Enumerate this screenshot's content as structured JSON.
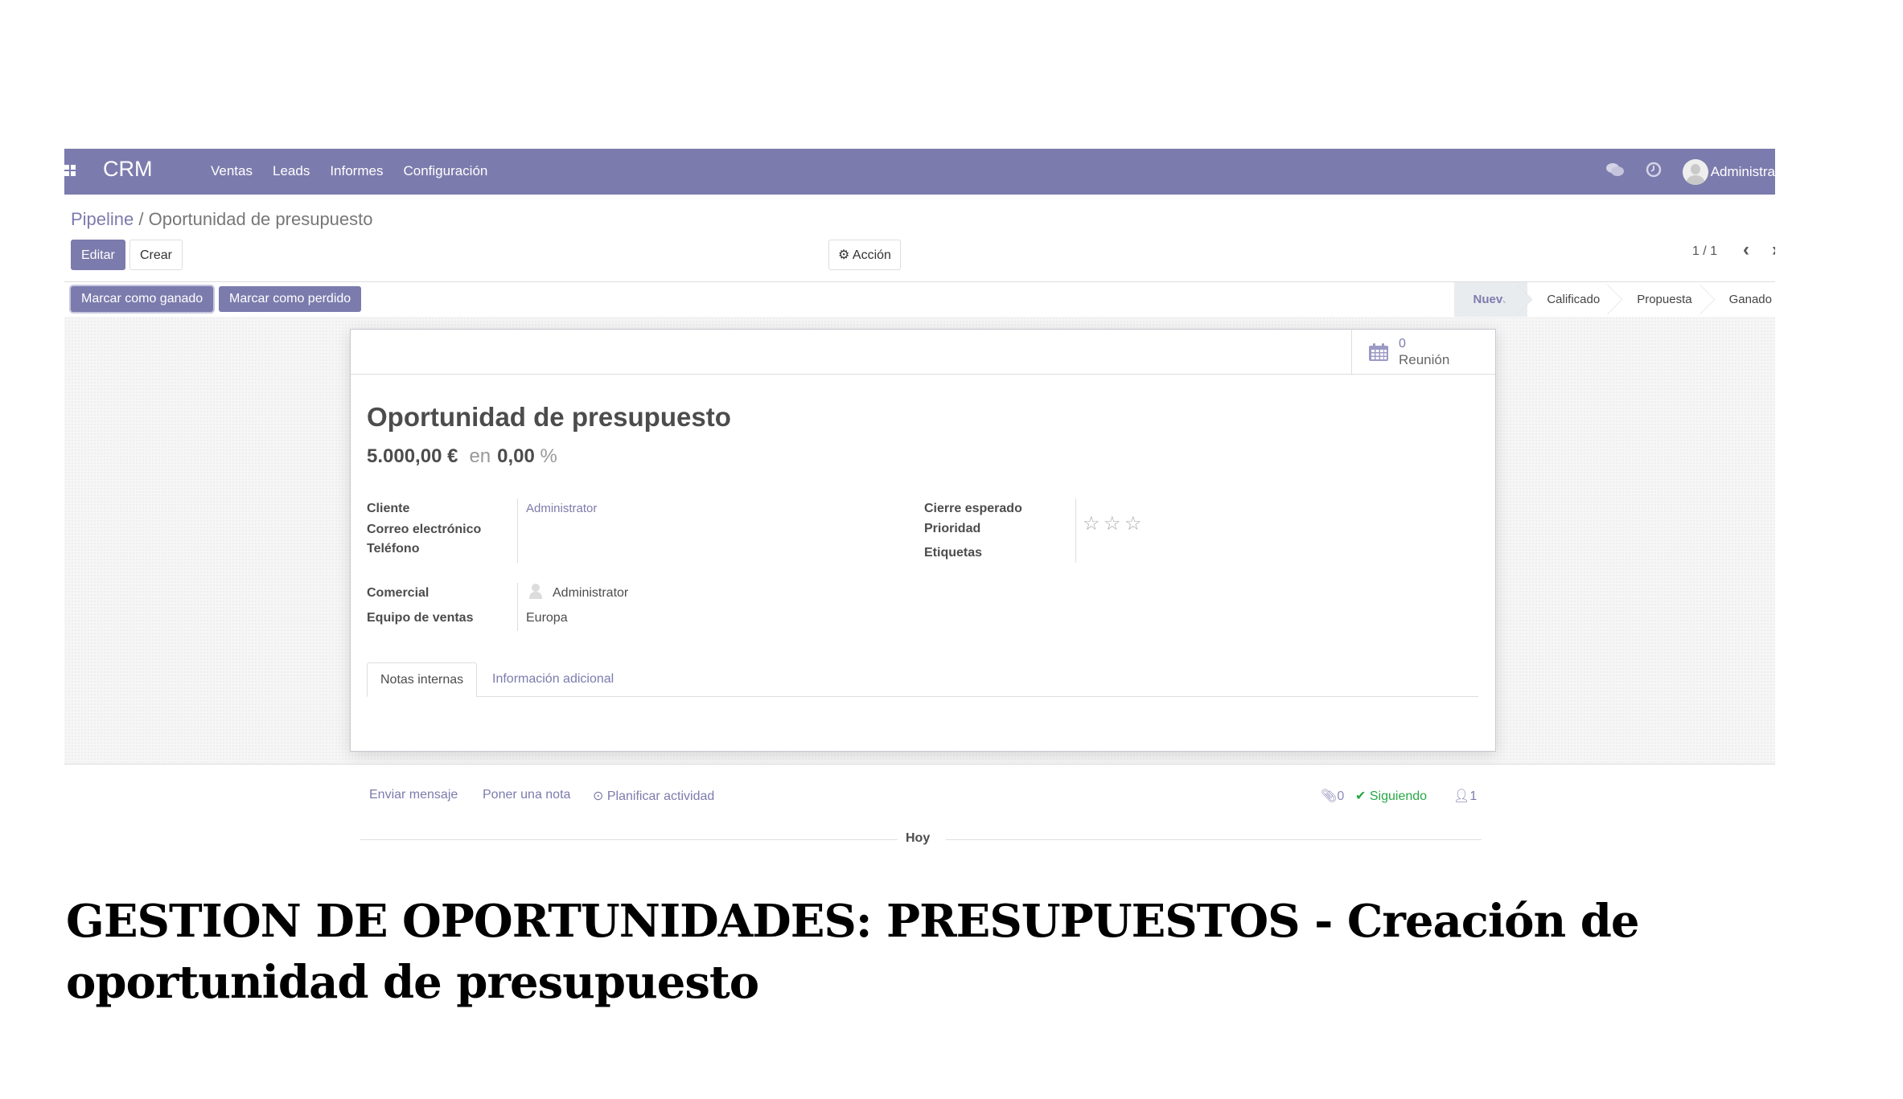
{
  "navbar": {
    "brand": "CRM",
    "menu": [
      "Ventas",
      "Leads",
      "Informes",
      "Configuración"
    ],
    "icons": [
      "apps-icon",
      "chat-icon",
      "clock-icon"
    ],
    "user": "Administra"
  },
  "breadcrumb": {
    "parent": "Pipeline",
    "separator": " / ",
    "current": "Oportunidad de presupuesto"
  },
  "toolbar": {
    "edit_label": "Editar",
    "create_label": "Crear",
    "action_label": "Acción",
    "pager": "1 / 1",
    "prev": "‹",
    "next": "›"
  },
  "statusbar": {
    "won_label": "Marcar como ganado",
    "lost_label": "Marcar como perdido",
    "stages": [
      "Nuevo",
      "Calificado",
      "Propuesta",
      "Ganado"
    ],
    "active_stage": "Nuevo"
  },
  "sheet": {
    "meetings": {
      "count": "0",
      "label": "Reunión"
    },
    "title": "Oportunidad de presupuesto",
    "revenue": "5.000,00 €",
    "in_label": "en",
    "probability": "0,00",
    "percent": "%",
    "left_fields": [
      {
        "label": "Cliente",
        "value": "Administrator"
      },
      {
        "label": "Correo electrónico",
        "value": ""
      },
      {
        "label": "Teléfono",
        "value": ""
      }
    ],
    "right_fields": [
      {
        "label": "Cierre esperado",
        "value": ""
      },
      {
        "label": "Prioridad",
        "value": "0 of 3 stars"
      },
      {
        "label": "Etiquetas",
        "value": ""
      }
    ],
    "priority": {
      "stars": 0,
      "max": 3
    },
    "sales_fields": [
      {
        "label": "Comercial",
        "value": "Administrator"
      },
      {
        "label": "Equipo de ventas",
        "value": "Europa"
      }
    ],
    "tabs": [
      "Notas internas",
      "Información adicional"
    ],
    "active_tab": "Notas internas"
  },
  "chatter": {
    "send_message": "Enviar mensaje",
    "log_note": "Poner una nota",
    "schedule_activity": "Planificar actividad",
    "attachments": "0",
    "following": "Siguiendo",
    "followers": "1",
    "today": "Hoy",
    "following_color": "#28a745"
  },
  "caption": {
    "text": "GESTION DE OPORTUNIDADES: PRESUPUESTOS - Creación de oportunidad de presupuesto"
  },
  "colors": {
    "brand": "#7c7bad",
    "text": "#4c4c4c"
  }
}
